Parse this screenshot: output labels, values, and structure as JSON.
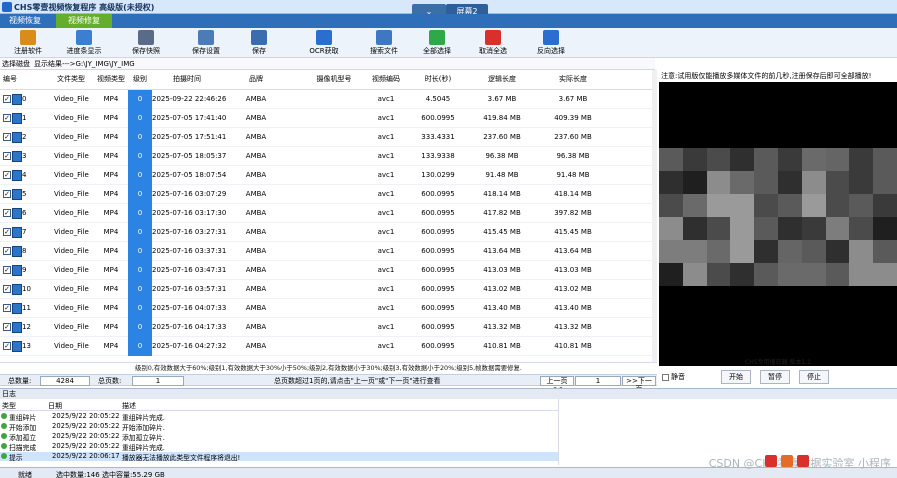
{
  "window": {
    "title": "CHS零壹视频恢复程序 高级版(未授权)"
  },
  "top_controls": {
    "down_arrow": "⌄",
    "screen": "屏幕2"
  },
  "tabs": [
    {
      "label": "视频恢复"
    },
    {
      "label": "视频修复"
    }
  ],
  "toolbar": [
    {
      "label": "注册软件",
      "icon": "register-icon",
      "color": "#d98c1c"
    },
    {
      "label": "进度条显示",
      "icon": "progress-icon",
      "color": "#3b7fd0"
    },
    {
      "label": "保存快照",
      "icon": "snapshot-icon",
      "color": "#5a6b8a"
    },
    {
      "label": "保存设置",
      "icon": "settings-icon",
      "color": "#4c7bb8"
    },
    {
      "label": "保存",
      "icon": "save-icon",
      "color": "#3a6db0"
    },
    {
      "label": "OCR获取",
      "icon": "ocr-icon",
      "color": "#2a6fd0"
    },
    {
      "label": "搜索文件",
      "icon": "search-icon",
      "color": "#3f78c2"
    },
    {
      "label": "全部选择",
      "icon": "check-all-icon",
      "color": "#2fa84a"
    },
    {
      "label": "取消全选",
      "icon": "uncheck-all-icon",
      "color": "#d9302c"
    },
    {
      "label": "反向选择",
      "icon": "invert-select-icon",
      "color": "#2a6fd0"
    }
  ],
  "pathbar": {
    "select_disk": "选择磁盘",
    "result": "显示结果--->G:\\JY_IMG\\JY_IMG"
  },
  "table": {
    "columns": [
      "编号",
      "文件类型",
      "视频类型",
      "级别",
      "拍摄时间",
      "品牌",
      "摄像机型号",
      "视频编码",
      "时长(秒)",
      "逻辑长度",
      "实际长度"
    ],
    "rows": [
      {
        "id": "0",
        "ftype": "Video_File",
        "vtype": "MP4",
        "level": "0",
        "time": "2025-09-22 22:46:26",
        "brand": "AMBA",
        "model": "",
        "codec": "avc1",
        "dur": "4.5045",
        "logical": "3.67 MB",
        "actual": "3.67 MB"
      },
      {
        "id": "1",
        "ftype": "Video_File",
        "vtype": "MP4",
        "level": "0",
        "time": "2025-07-05 17:41:40",
        "brand": "AMBA",
        "model": "",
        "codec": "avc1",
        "dur": "600.0995",
        "logical": "419.84 MB",
        "actual": "409.39 MB"
      },
      {
        "id": "2",
        "ftype": "Video_File",
        "vtype": "MP4",
        "level": "0",
        "time": "2025-07-05 17:51:41",
        "brand": "AMBA",
        "model": "",
        "codec": "avc1",
        "dur": "333.4331",
        "logical": "237.60 MB",
        "actual": "237.60 MB"
      },
      {
        "id": "3",
        "ftype": "Video_File",
        "vtype": "MP4",
        "level": "0",
        "time": "2025-07-05 18:05:37",
        "brand": "AMBA",
        "model": "",
        "codec": "avc1",
        "dur": "133.9338",
        "logical": "96.38 MB",
        "actual": "96.38 MB"
      },
      {
        "id": "4",
        "ftype": "Video_File",
        "vtype": "MP4",
        "level": "0",
        "time": "2025-07-05 18:07:54",
        "brand": "AMBA",
        "model": "",
        "codec": "avc1",
        "dur": "130.0299",
        "logical": "91.48 MB",
        "actual": "91.48 MB"
      },
      {
        "id": "5",
        "ftype": "Video_File",
        "vtype": "MP4",
        "level": "0",
        "time": "2025-07-16 03:07:29",
        "brand": "AMBA",
        "model": "",
        "codec": "avc1",
        "dur": "600.0995",
        "logical": "418.14 MB",
        "actual": "418.14 MB"
      },
      {
        "id": "6",
        "ftype": "Video_File",
        "vtype": "MP4",
        "level": "0",
        "time": "2025-07-16 03:17:30",
        "brand": "AMBA",
        "model": "",
        "codec": "avc1",
        "dur": "600.0995",
        "logical": "417.82 MB",
        "actual": "397.82 MB"
      },
      {
        "id": "7",
        "ftype": "Video_File",
        "vtype": "MP4",
        "level": "0",
        "time": "2025-07-16 03:27:31",
        "brand": "AMBA",
        "model": "",
        "codec": "avc1",
        "dur": "600.0995",
        "logical": "415.45 MB",
        "actual": "415.45 MB"
      },
      {
        "id": "8",
        "ftype": "Video_File",
        "vtype": "MP4",
        "level": "0",
        "time": "2025-07-16 03:37:31",
        "brand": "AMBA",
        "model": "",
        "codec": "avc1",
        "dur": "600.0995",
        "logical": "413.64 MB",
        "actual": "413.64 MB"
      },
      {
        "id": "9",
        "ftype": "Video_File",
        "vtype": "MP4",
        "level": "0",
        "time": "2025-07-16 03:47:31",
        "brand": "AMBA",
        "model": "",
        "codec": "avc1",
        "dur": "600.0995",
        "logical": "413.03 MB",
        "actual": "413.03 MB"
      },
      {
        "id": "10",
        "ftype": "Video_File",
        "vtype": "MP4",
        "level": "0",
        "time": "2025-07-16 03:57:31",
        "brand": "AMBA",
        "model": "",
        "codec": "avc1",
        "dur": "600.0995",
        "logical": "413.02 MB",
        "actual": "413.02 MB"
      },
      {
        "id": "11",
        "ftype": "Video_File",
        "vtype": "MP4",
        "level": "0",
        "time": "2025-07-16 04:07:33",
        "brand": "AMBA",
        "model": "",
        "codec": "avc1",
        "dur": "600.0995",
        "logical": "413.40 MB",
        "actual": "413.40 MB"
      },
      {
        "id": "12",
        "ftype": "Video_File",
        "vtype": "MP4",
        "level": "0",
        "time": "2025-07-16 04:17:33",
        "brand": "AMBA",
        "model": "",
        "codec": "avc1",
        "dur": "600.0995",
        "logical": "413.32 MB",
        "actual": "413.32 MB"
      },
      {
        "id": "13",
        "ftype": "Video_File",
        "vtype": "MP4",
        "level": "0",
        "time": "2025-07-16 04:27:32",
        "brand": "AMBA",
        "model": "",
        "codec": "avc1",
        "dur": "600.0995",
        "logical": "410.81 MB",
        "actual": "410.81 MB"
      }
    ]
  },
  "legend_text": "级别0,有效数据大于60%;级别1,有效数据大于30%小于50%;级别2,有效数据小于30%;级别3,有效数据小于20%;级别5,帧数据需要修复.",
  "summary": {
    "total_label": "总数量:",
    "total": "4284",
    "pages_label": "总页数:",
    "pages": "1",
    "hint": "总页数超过1页的,请点击\"上一页\"或\"下一页\"进行查看",
    "prev": "上一页<<",
    "page_input": "1",
    "next": ">>下一页"
  },
  "player": {
    "notice": "注意:试用版仅能播放多媒体文件的前几秒,注册保存后即可全部播放!",
    "title": "CHS专用播放器 版本1.1",
    "mute": "静音",
    "start": "开始",
    "pause": "暂停",
    "stop": "停止"
  },
  "log": {
    "title": "日志",
    "columns": [
      "类型",
      "日期",
      "描述"
    ],
    "rows": [
      {
        "type": "重组碎片",
        "date": "2025/9/22 20:05:22",
        "desc": "重组碎片完成."
      },
      {
        "type": "开始添加",
        "date": "2025/9/22 20:05:22",
        "desc": "开始添加碎片."
      },
      {
        "type": "添加孤立",
        "date": "2025/9/22 20:05:22",
        "desc": "添加孤立碎片."
      },
      {
        "type": "扫描完成",
        "date": "2025/9/22 20:05:22",
        "desc": "重组碎片完成."
      },
      {
        "type": "提示",
        "date": "2025/9/22 20:06:17",
        "desc": "播放器无法播放此类型文件程序将退出!"
      }
    ]
  },
  "status": {
    "ready": "就绪",
    "selected": "选中数量:146 选中容量:55.29 GB"
  },
  "watermark": "CSDN @CHS零壹数据实验室 小程序"
}
